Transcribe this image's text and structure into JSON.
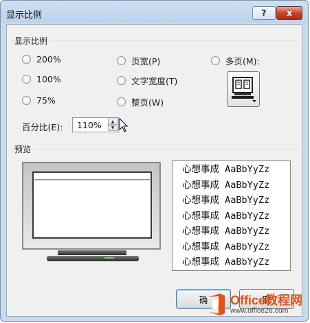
{
  "window": {
    "title": "显示比例"
  },
  "titlebar": {
    "help_label": "?",
    "close_label": "x"
  },
  "zoom_group": {
    "label": "显示比例",
    "options": [
      {
        "label": "200%",
        "selected": false
      },
      {
        "label": "100%",
        "selected": false
      },
      {
        "label": "75%",
        "selected": false
      },
      {
        "label": "页宽(P)",
        "selected": false
      },
      {
        "label": "文字宽度(T)",
        "selected": false
      },
      {
        "label": "整页(W)",
        "selected": false
      },
      {
        "label": "多页(M):",
        "selected": false
      }
    ],
    "pages_button_icon": "monitor-pages-icon"
  },
  "percent": {
    "label": "百分比(E):",
    "value": "110%"
  },
  "preview": {
    "label": "预览",
    "sample_lines": [
      "心想事成 AaBbYyZz",
      "心想事成 AaBbYyZz",
      "心想事成 AaBbYyZz",
      "心想事成 AaBbYyZz",
      "心想事成 AaBbYyZz",
      "心想事成 AaBbYyZz",
      "心想事成 AaBbYyZz"
    ]
  },
  "buttons": {
    "ok_label": "确",
    "cancel_label": "取"
  },
  "watermark": {
    "brand": "Office教程网",
    "url": "www.office26.com"
  },
  "colors": {
    "title_gradient": "#bcd3ee",
    "client_bg": "#f0f0f0",
    "close_red": "#c7432e",
    "watermark_orange": "#e0531c"
  }
}
